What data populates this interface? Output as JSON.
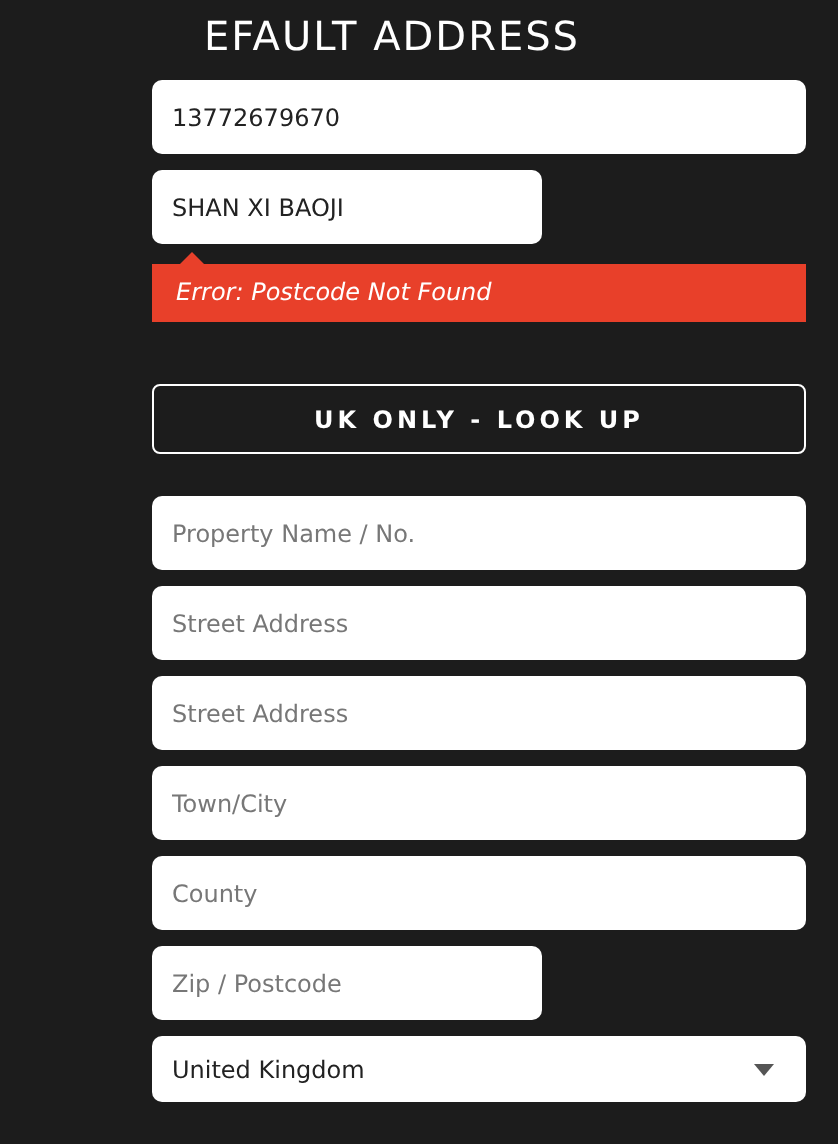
{
  "title": "EFAULT ADDRESS",
  "fields": [
    {
      "kind": "value",
      "value": "13772679670",
      "short": false
    },
    {
      "kind": "value",
      "value": "SHAN XI BAOJI",
      "short": true
    },
    {
      "kind": "error",
      "text": "Error: Postcode Not Found"
    },
    {
      "kind": "button",
      "text": "UK ONLY - LOOK UP"
    },
    {
      "kind": "placeholder",
      "placeholder": "Property Name / No.",
      "short": false
    },
    {
      "kind": "placeholder",
      "placeholder": "Street Address",
      "short": false
    },
    {
      "kind": "placeholder",
      "placeholder": "Street Address",
      "short": false
    },
    {
      "kind": "placeholder",
      "placeholder": "Town/City",
      "short": false
    },
    {
      "kind": "placeholder",
      "placeholder": "County",
      "short": false
    },
    {
      "kind": "placeholder",
      "placeholder": "Zip / Postcode",
      "short": true
    },
    {
      "kind": "select",
      "value": "United Kingdom"
    }
  ]
}
